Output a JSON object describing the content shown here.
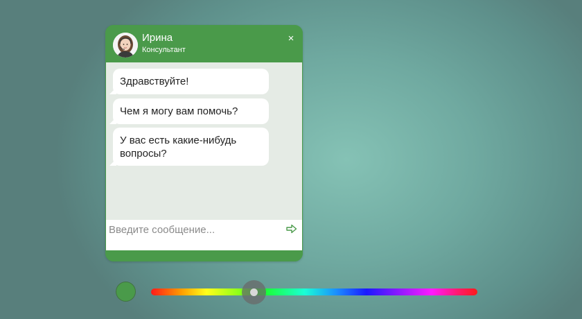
{
  "chat": {
    "agent_name": "Ирина",
    "agent_role": "Консультант",
    "close_label": "×",
    "messages": [
      "Здравствуйте!",
      "Чем я могу вам помочь?",
      "У вас есть какие-нибудь вопросы?"
    ],
    "input_placeholder": "Введите сообщение...",
    "input_value": "",
    "send_icon": "arrow-right-outline-icon"
  },
  "theme": {
    "accent_color": "#4a9a4a",
    "message_area_color": "#e5ebe5",
    "bubble_color": "#ffffff"
  },
  "color_picker": {
    "selected_color": "#4a9a4a",
    "hue_position_fraction": 0.31
  }
}
